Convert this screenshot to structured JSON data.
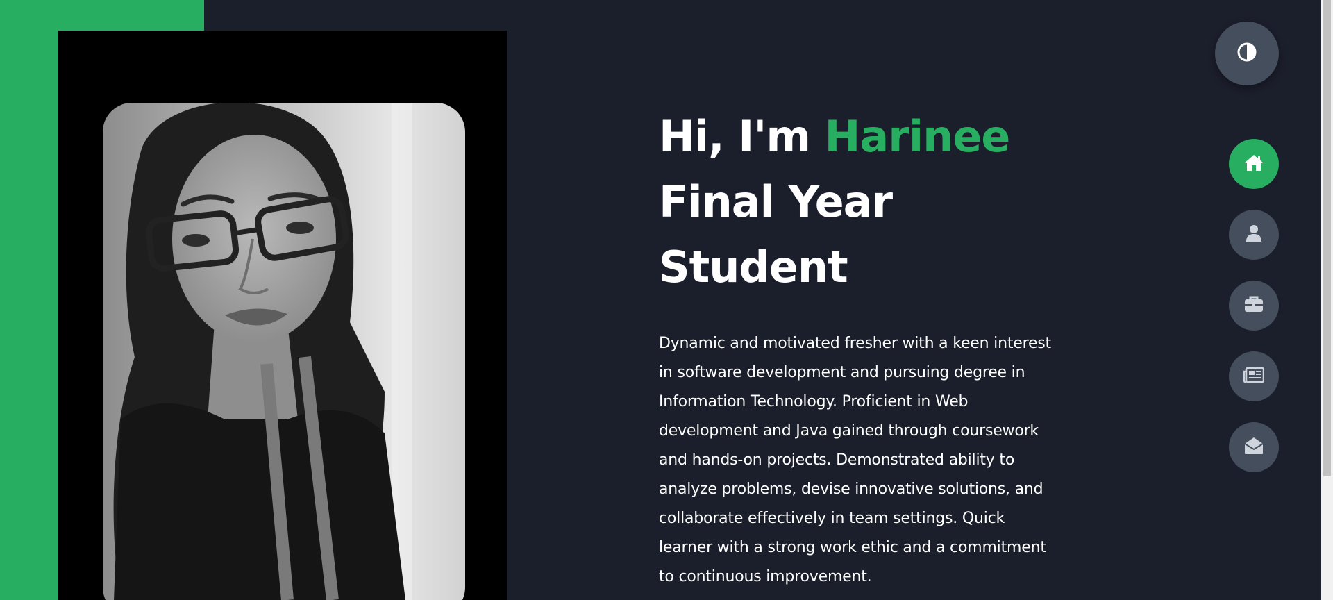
{
  "hero": {
    "greeting": "Hi, I'm ",
    "name": "Harinee",
    "role_line1": "Final Year",
    "role_line2": "Student",
    "bio": "Dynamic and motivated fresher with a keen interest in software development and pursuing degree in Information Technology. Proficient in Web development and Java gained through coursework and hands-on projects. Demonstrated ability to analyze problems, devise innovative solutions, and collaborate effectively in team settings. Quick learner with a strong work ethic and a commitment to continuous improvement."
  },
  "nav": {
    "items": [
      {
        "icon": "home-icon",
        "active": true
      },
      {
        "icon": "user-icon",
        "active": false
      },
      {
        "icon": "briefcase-icon",
        "active": false
      },
      {
        "icon": "newspaper-icon",
        "active": false
      },
      {
        "icon": "envelope-open-icon",
        "active": false
      }
    ]
  },
  "theme_toggle": {
    "icon": "contrast-icon"
  },
  "colors": {
    "background": "#1b1e2b",
    "accent": "#27ae60",
    "button": "#454e5c",
    "text": "#ffffff"
  }
}
